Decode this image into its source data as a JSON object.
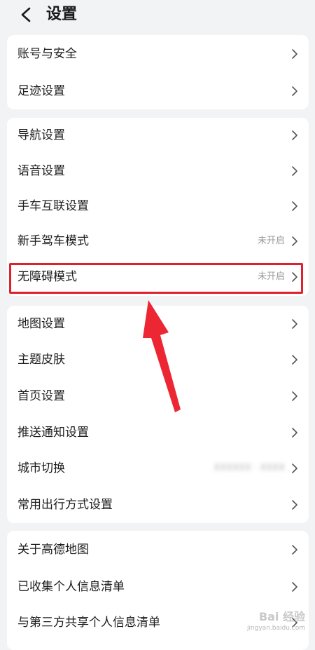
{
  "header": {
    "title": "设置"
  },
  "groups": [
    {
      "items": [
        {
          "label": "账号与安全",
          "value": ""
        },
        {
          "label": "足迹设置",
          "value": ""
        }
      ]
    },
    {
      "items": [
        {
          "label": "导航设置",
          "value": ""
        },
        {
          "label": "语音设置",
          "value": ""
        },
        {
          "label": "手车互联设置",
          "value": ""
        },
        {
          "label": "新手驾车模式",
          "value": "未开启"
        },
        {
          "label": "无障碍模式",
          "value": "未开启"
        }
      ]
    },
    {
      "items": [
        {
          "label": "地图设置",
          "value": ""
        },
        {
          "label": "主题皮肤",
          "value": ""
        },
        {
          "label": "首页设置",
          "value": ""
        },
        {
          "label": "推送通知设置",
          "value": ""
        },
        {
          "label": "城市切换",
          "value": "XXXXXX · XXXX"
        },
        {
          "label": "常用出行方式设置",
          "value": ""
        }
      ]
    },
    {
      "items": [
        {
          "label": "关于高德地图",
          "value": ""
        },
        {
          "label": "已收集个人信息清单",
          "value": ""
        },
        {
          "label": "与第三方共享个人信息清单",
          "value": ""
        }
      ]
    }
  ],
  "watermark": {
    "brand": "Bai 经验",
    "url": "jingyan.baidu.com"
  },
  "colors": {
    "background": "#f2f3f5",
    "card": "#ffffff",
    "highlight": "#e0202c",
    "secondary_text": "#9a9a9a"
  },
  "icons": {
    "back": "chevron-left-icon",
    "row": "chevron-right-icon"
  }
}
